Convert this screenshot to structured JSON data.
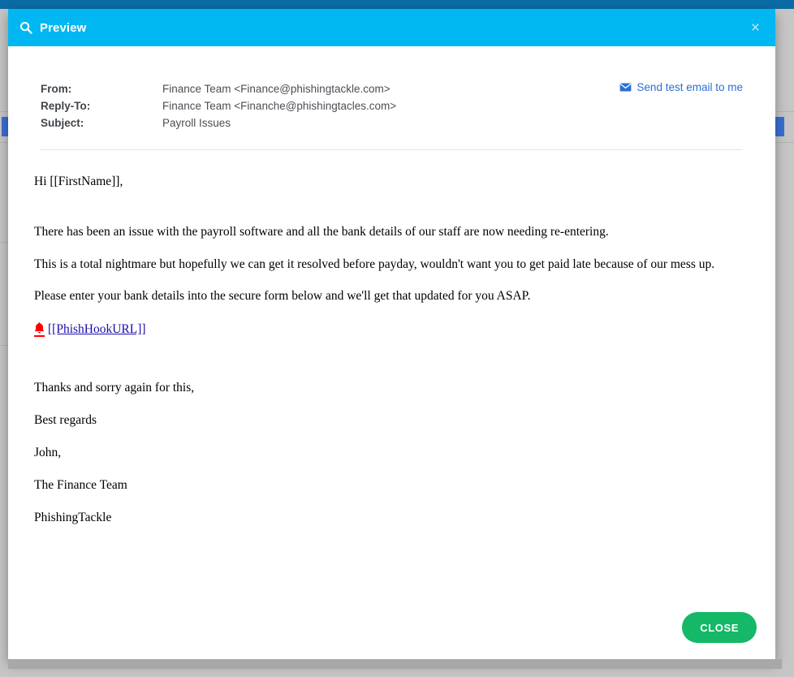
{
  "modal": {
    "title": "Preview",
    "title_icon": "search-icon",
    "close_icon": "close-icon",
    "close_icon_glyph": "×"
  },
  "meta": {
    "rows": [
      {
        "label": "From:",
        "value": "Finance Team <Finance@phishingtackle.com>"
      },
      {
        "label": "Reply-To:",
        "value": "Finance Team <Finanche@phishingtacles.com>"
      },
      {
        "label": "Subject:",
        "value": "Payroll Issues"
      }
    ],
    "send_test_label": "Send test email to me",
    "send_test_icon": "envelope-icon"
  },
  "email": {
    "greeting": "Hi [[FirstName]],",
    "paragraphs": [
      "There has been an issue with the payroll software and all the bank details of our staff are now needing re-entering.",
      "This is a total nightmare but hopefully we can get it resolved before payday, wouldn't want you to get paid late because of our mess up.",
      "Please enter your bank details into the secure form below and we'll get that updated for you ASAP."
    ],
    "phish_link_icon": "bell-icon",
    "phish_link_text": "[[PhishHookURL]]",
    "signature": [
      "Thanks and sorry again for this,",
      "Best regards",
      "John,",
      "The Finance Team",
      "PhishingTackle"
    ]
  },
  "footer": {
    "close_label": "CLOSE"
  },
  "colors": {
    "header_background": "#00b7f1",
    "close_button": "#14b866",
    "link": "#2a6fd4",
    "phish_link": "#1a0dab",
    "bell": "#ff0000",
    "app_topbar": "#0b6ba5",
    "backdrop": "#c6c6c6"
  }
}
